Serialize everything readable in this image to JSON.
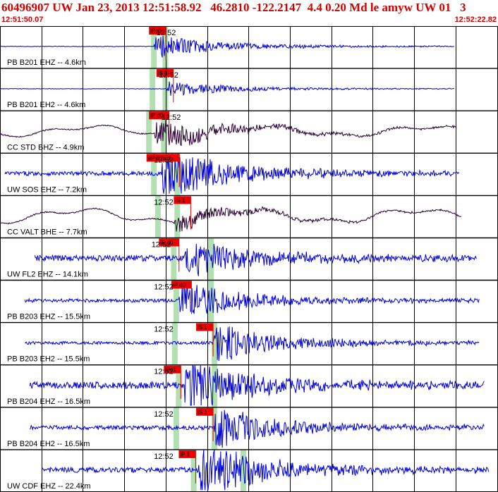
{
  "header": {
    "title": "60496907 UW Jan 23, 2013 12:51:58.92   46.2810 -122.2147  4.4 0.20 Md le amyw UW 01   3",
    "start_time": "12:51:50.07",
    "end_time": "12:52:22.82"
  },
  "colors": {
    "header_text": "#d40000",
    "trace_blue": "#0000dd",
    "trace_dark": "#2a0033",
    "pick_box": "#ee0000",
    "pick_band": "#b3e0b3",
    "grid": "#000000"
  },
  "chart_data": {
    "type": "line",
    "title": "60496907 UW Jan 23, 2013 12:51:58.92   46.2810 -122.2147  4.4 0.20 Md le amyw UW 01   3",
    "x_range_label": [
      "12:51:50.07",
      "12:52:22.82"
    ],
    "tick_label": "12:52",
    "series": [
      {
        "name": "PB B201 EHZ -- 4.6km",
        "color": "#0000dd",
        "start": 0.0,
        "end": 0.915,
        "onset": 0.31,
        "amp": 0.12,
        "bg": 0.015,
        "wander": 0,
        "pick": "iPc0",
        "pick_pos": 0.3,
        "bands": [
          0.31,
          0.333
        ],
        "tick_pos": 0.315
      },
      {
        "name": "PB B201 EH2 -- 4.6km",
        "color": "#0000dd",
        "start": 0.0,
        "end": 0.915,
        "onset": 0.335,
        "amp": 0.08,
        "bg": 0.012,
        "wander": 0,
        "pick": "iS 2",
        "pick_pos": 0.315,
        "bands": [
          0.307,
          0.333
        ],
        "tick_pos": 0.32
      },
      {
        "name": "CC STD BHZ -- 4.9km",
        "color": "#2a0033",
        "start": 0.0,
        "end": 0.92,
        "onset": 0.31,
        "amp": 0.15,
        "bg": 0.03,
        "wander": 0.22,
        "pick": "iP d0",
        "pick_pos": 0.3,
        "bands": [
          0.3,
          0.33
        ],
        "tick_pos": 0.325
      },
      {
        "name": "UW SOS EHZ -- 7.2km",
        "color": "#0000dd",
        "start": 0.01,
        "end": 0.925,
        "onset": 0.325,
        "amp": 0.28,
        "bg": 0.1,
        "wander": 0,
        "pick": "eP d iS 1",
        "pick_pos": 0.295,
        "bands": [
          0.31,
          0.357
        ],
        "tick_pos": 0.31
      },
      {
        "name": "CC VALT BHE -- 7.7km",
        "color": "#2a0033",
        "start": 0.0,
        "end": 0.93,
        "onset": 0.35,
        "amp": 0.1,
        "bg": 0.03,
        "wander": 0.3,
        "pick": "iS 1",
        "pick_pos": 0.35,
        "bands": [
          0.318,
          0.357
        ],
        "tick_pos": 0.31
      },
      {
        "name": "UW FL2 EHZ -- 14.1km",
        "color": "#0000dd",
        "start": 0.07,
        "end": 0.96,
        "onset": 0.37,
        "amp": 0.22,
        "bg": 0.14,
        "wander": 0,
        "pick": "iP d0",
        "pick_pos": 0.32,
        "bands": [
          0.35,
          0.425
        ],
        "tick_pos": 0.305
      },
      {
        "name": "PB B203 EHZ -- 15.5km",
        "color": "#0000dd",
        "start": 0.05,
        "end": 0.965,
        "onset": 0.36,
        "amp": 0.22,
        "bg": 0.08,
        "wander": 0,
        "pick": "iP d0",
        "pick_pos": 0.345,
        "bands": [
          0.355,
          0.425
        ],
        "tick_pos": 0.31
      },
      {
        "name": "PB B203 EH2 -- 15.5km",
        "color": "#0000dd",
        "start": 0.05,
        "end": 0.965,
        "onset": 0.43,
        "amp": 0.2,
        "bg": 0.07,
        "wander": 0,
        "pick": "iS 1",
        "pick_pos": 0.395,
        "bands": [
          0.352,
          0.432
        ],
        "tick_pos": 0.31
      },
      {
        "name": "PB B204 EHZ -- 16.5km",
        "color": "#0000dd",
        "start": 0.06,
        "end": 0.975,
        "onset": 0.37,
        "amp": 0.28,
        "bg": 0.16,
        "wander": 0,
        "pick": "iPc1",
        "pick_pos": 0.33,
        "bands": [
          0.36,
          0.432
        ],
        "tick_pos": 0.31
      },
      {
        "name": "PB B204 EH2 -- 16.5km",
        "color": "#0000dd",
        "start": 0.06,
        "end": 0.975,
        "onset": 0.43,
        "amp": 0.22,
        "bg": 0.1,
        "wander": 0,
        "pick": "iS 1",
        "pick_pos": 0.395,
        "bands": [
          0.355,
          0.432
        ],
        "tick_pos": 0.31
      },
      {
        "name": "UW CDF EHZ -- 22.4km",
        "color": "#0000dd",
        "start": 0.085,
        "end": 0.985,
        "onset": 0.4,
        "amp": 0.3,
        "bg": 0.12,
        "wander": 0,
        "pick": "iP 1",
        "pick_pos": 0.36,
        "bands": [
          0.39,
          0.49
        ],
        "tick_pos": 0.31
      }
    ]
  }
}
